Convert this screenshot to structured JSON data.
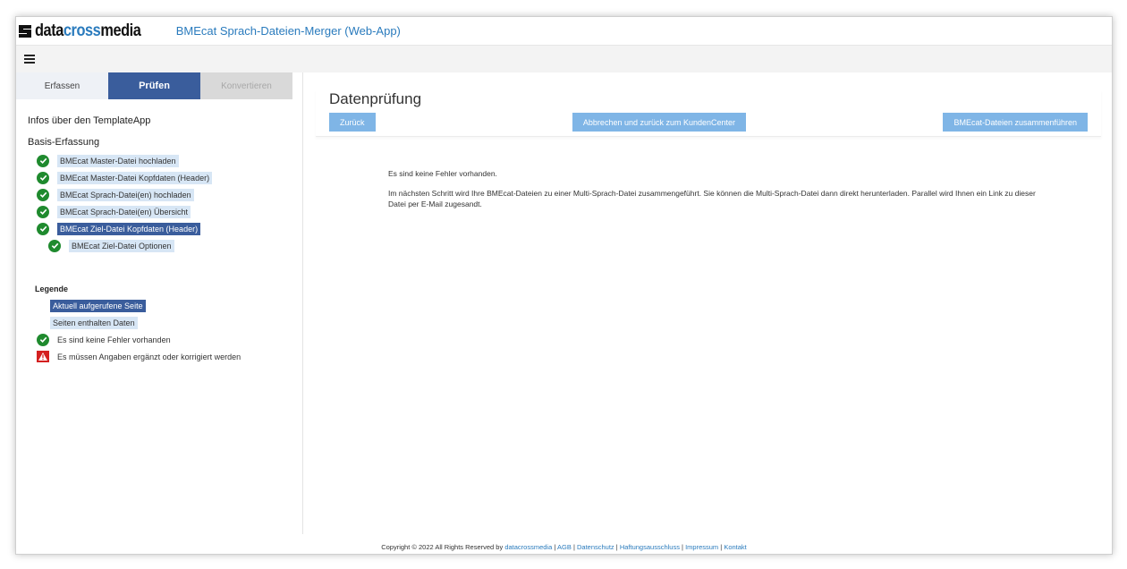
{
  "brand": {
    "logo_dark": "data",
    "logo_accent": "cross",
    "logo_dark2": "media",
    "app_title": "BMEcat Sprach-Dateien-Merger (Web-App)"
  },
  "tabs": [
    {
      "label": "Erfassen",
      "state": "normal"
    },
    {
      "label": "Prüfen",
      "state": "active"
    },
    {
      "label": "Konvertieren",
      "state": "disabled"
    }
  ],
  "sidebar": {
    "info_heading": "Infos über den TemplateApp",
    "section_heading": "Basis-Erfassung",
    "steps": [
      {
        "label": "BMEcat Master-Datei hochladen",
        "status": "ok"
      },
      {
        "label": "BMEcat Master-Datei Kopfdaten (Header)",
        "status": "ok"
      },
      {
        "label": "BMEcat Sprach-Datei(en) hochladen",
        "status": "ok"
      },
      {
        "label": "BMEcat Sprach-Datei(en) Übersicht",
        "status": "ok"
      },
      {
        "label": "BMEcat Ziel-Datei Kopfdaten (Header)",
        "status": "ok",
        "current": true
      },
      {
        "label": "BMEcat Ziel-Datei Optionen",
        "status": "ok",
        "sub": true
      }
    ],
    "legend": {
      "title": "Legende",
      "current_page": "Aktuell aufgerufene Seite",
      "has_data": "Seiten enthalten Daten",
      "no_errors": "Es sind keine Fehler vorhanden",
      "needs_fix": "Es müssen Angaben ergänzt oder korrigiert werden"
    }
  },
  "main": {
    "title": "Datenprüfung",
    "btn_back": "Zurück",
    "btn_cancel": "Abbrechen und zurück zum KundenCenter",
    "btn_merge": "BMEcat-Dateien zusammenführen",
    "message_1": "Es sind keine Fehler vorhanden.",
    "message_2": "Im nächsten Schritt wird Ihre BMEcat-Dateien zu einer Multi-Sprach-Datei zusammengeführt. Sie können die Multi-Sprach-Datei dann direkt herunterladen. Parallel wird Ihnen ein Link zu dieser Datei per E-Mail zugesandt."
  },
  "footer": {
    "copyright": "Copyright © 2022 All Rights Reserved by",
    "brand_link": "datacrossmedia",
    "sep": "|",
    "links": [
      "AGB",
      "Datenschutz",
      "Haftungsausschluss",
      "Impressum",
      "Kontakt"
    ]
  },
  "colors": {
    "accent": "#2a7bbd",
    "tab_active": "#3a5d9c",
    "button": "#7fb5e6",
    "ok": "#1f8a2e",
    "warn": "#d42020"
  }
}
